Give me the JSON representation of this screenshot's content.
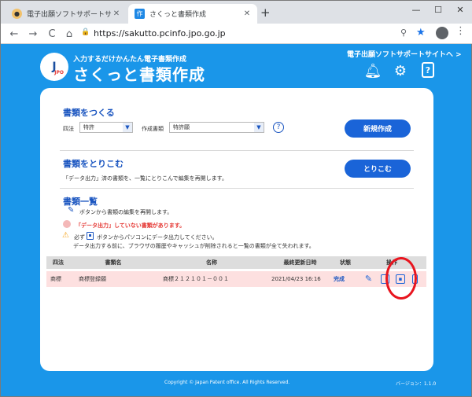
{
  "browser": {
    "tabs": [
      {
        "title": "電子出願ソフトサポートサイト さくっと",
        "favicon": "jpo-favicon"
      },
      {
        "title": "さくっと書類作成",
        "favicon": "app-favicon",
        "favicon_glyph": "作"
      }
    ],
    "new_tab": "+",
    "window_controls": {
      "minimize": "—",
      "maximize": "☐",
      "close": "✕"
    },
    "url": "https://sakutto.pcinfo.jpo.go.jp",
    "nav": {
      "back": "←",
      "forward": "→",
      "reload": "C",
      "home": "⌂"
    }
  },
  "header": {
    "logo_text": "J",
    "logo_sub": "JPO",
    "tagline": "入力するだけかんたん電子書類作成",
    "app_title": "さくっと書類作成",
    "support_link": "電子出願ソフトサポートサイトへ >",
    "icons": [
      "bell-icon",
      "gear-icon",
      "help-doc-icon"
    ]
  },
  "create": {
    "title": "書類をつくる",
    "law_label": "四法",
    "law_value": "特許",
    "doc_label": "作成書類",
    "doc_value": "特許願",
    "help": "?",
    "button": "新規作成"
  },
  "import": {
    "title": "書類をとりこむ",
    "description": "「データ出力」済の書類を、一覧にとりこんで編集を再開します。",
    "button": "とりこむ"
  },
  "list": {
    "title": "書類一覧",
    "edit_hint": "ボタンから書類の編集を再開します。",
    "warning_pink": "「データ出力」していない書類があります。",
    "warn_must": "必ず",
    "warn_button_text": "ボタンからパソコンにデータ出力してください。",
    "warn_line2": "データ出力する前に、ブラウザの履歴やキャッシュが削除されると一覧の書類が全て失われます。",
    "columns": [
      "四法",
      "書類名",
      "名称",
      "最終更新日時",
      "状態",
      "操作"
    ],
    "rows": [
      {
        "law": "商標",
        "doc_name": "商標登録願",
        "title": "商標２１２１０１－００１",
        "updated": "2021/04/23 16:16",
        "status": "完成"
      }
    ]
  },
  "footer": {
    "copyright": "Copyright © Japan Patent office. All Rights Reserved.",
    "version": "バージョン：1.1.0"
  },
  "colors": {
    "background": "#1a96e9",
    "accent": "#1a64d8",
    "row_highlight": "#fde0e0",
    "annotation": "#e8141e"
  }
}
